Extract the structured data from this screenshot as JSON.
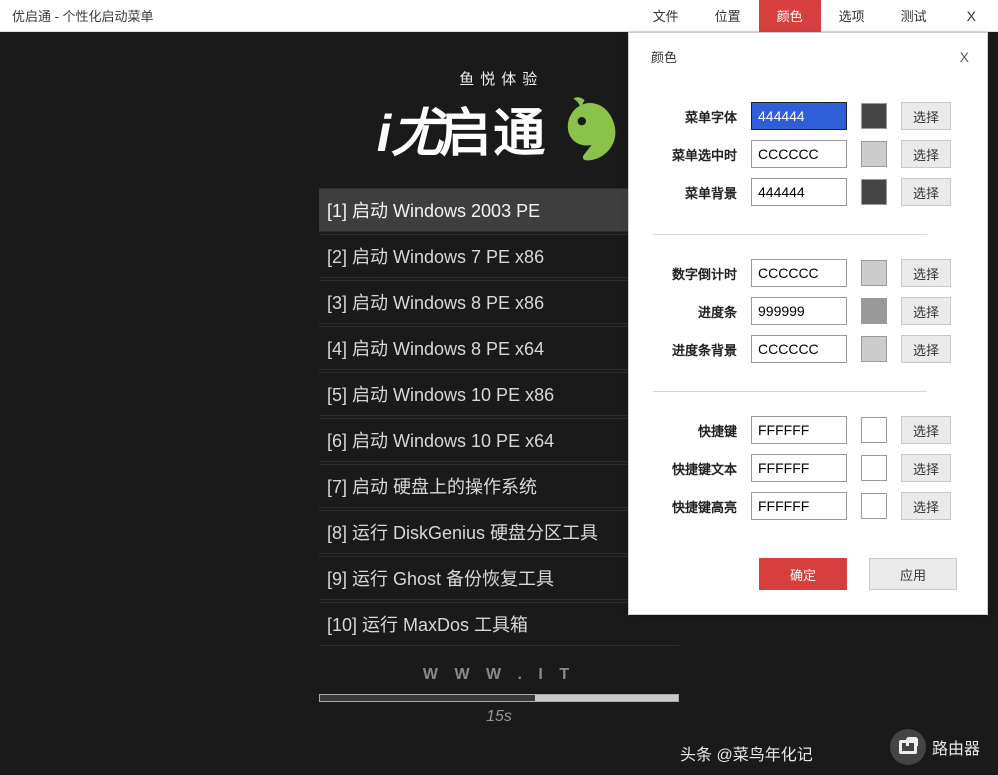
{
  "titlebar": {
    "title": "优启通 - 个性化启动菜单",
    "menu": [
      "文件",
      "位置",
      "颜色",
      "选项",
      "测试"
    ],
    "close": "X",
    "active_index": 2
  },
  "preview": {
    "logo_subtitle": "鱼悦体验",
    "logo_prefix": "i尤",
    "logo_main": "启通",
    "items": [
      "[1] 启动 Windows 2003 PE",
      "[2] 启动 Windows 7 PE x86",
      "[3] 启动 Windows 8 PE x86",
      "[4] 启动 Windows 8 PE x64",
      "[5] 启动 Windows 10 PE x86",
      "[6] 启动 Windows 10 PE x64",
      "[7] 启动 硬盘上的操作系统",
      "[8] 运行 DiskGenius 硬盘分区工具",
      "[9] 运行 Ghost 备份恢复工具",
      "[10] 运行 MaxDos 工具箱"
    ],
    "selected_index": 0,
    "footer_url": "W W W . I T",
    "countdown": "15s"
  },
  "color_panel": {
    "title": "颜色",
    "close": "X",
    "choose_label": "选择",
    "rows": [
      {
        "label": "菜单字体",
        "value": "444444",
        "swatch": "#444444",
        "selected": true
      },
      {
        "label": "菜单选中时",
        "value": "CCCCCC",
        "swatch": "#cccccc"
      },
      {
        "label": "菜单背景",
        "value": "444444",
        "swatch": "#444444"
      },
      {
        "label": "数字倒计时",
        "value": "CCCCCC",
        "swatch": "#cccccc"
      },
      {
        "label": "进度条",
        "value": "999999",
        "swatch": "#999999"
      },
      {
        "label": "进度条背景",
        "value": "CCCCCC",
        "swatch": "#cccccc"
      },
      {
        "label": "快捷键",
        "value": "FFFFFF",
        "swatch": "#ffffff"
      },
      {
        "label": "快捷键文本",
        "value": "FFFFFF",
        "swatch": "#ffffff"
      },
      {
        "label": "快捷键高亮",
        "value": "FFFFFF",
        "swatch": "#ffffff"
      }
    ],
    "groups": [
      [
        0,
        1,
        2
      ],
      [
        3,
        4,
        5
      ],
      [
        6,
        7,
        8
      ]
    ],
    "ok": "确定",
    "apply": "应用"
  },
  "watermark": {
    "left": "头条 @菜鸟年化记",
    "right": "路由器"
  }
}
